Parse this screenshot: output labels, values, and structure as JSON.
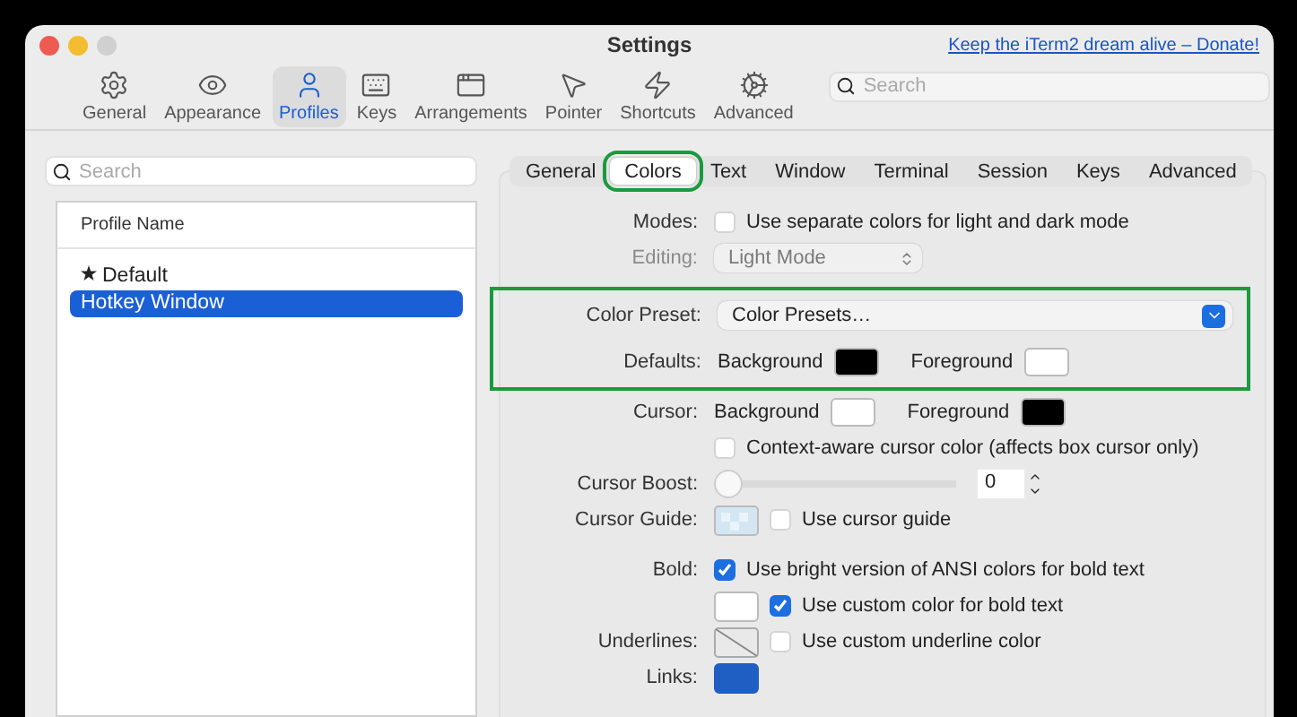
{
  "window": {
    "title": "Settings",
    "link": "Keep the iTerm2 dream alive – Donate!"
  },
  "toolbar": [
    {
      "label": "General",
      "kind": "general",
      "selected": false
    },
    {
      "label": "Appearance",
      "kind": "appearance",
      "selected": false
    },
    {
      "label": "Profiles",
      "kind": "profiles",
      "selected": true
    },
    {
      "label": "Keys",
      "kind": "keys",
      "selected": false
    },
    {
      "label": "Arrangements",
      "kind": "arrangements",
      "selected": false
    },
    {
      "label": "Pointer",
      "kind": "pointer",
      "selected": false
    },
    {
      "label": "Shortcuts",
      "kind": "shortcuts",
      "selected": false
    },
    {
      "label": "Advanced",
      "kind": "advanced",
      "selected": false
    }
  ],
  "toolbar_search": {
    "placeholder": "Search"
  },
  "profiles": {
    "search": {
      "placeholder": "Search"
    },
    "column": "Profile Name",
    "items": [
      {
        "name": "Default",
        "default": true,
        "selected": false
      },
      {
        "name": "Hotkey Window",
        "default": false,
        "selected": true
      }
    ]
  },
  "tabs": [
    {
      "label": "General",
      "selected": false,
      "highlighted": false
    },
    {
      "label": "Colors",
      "selected": true,
      "highlighted": true
    },
    {
      "label": "Text",
      "selected": false,
      "highlighted": false
    },
    {
      "label": "Window",
      "selected": false,
      "highlighted": false
    },
    {
      "label": "Terminal",
      "selected": false,
      "highlighted": false
    },
    {
      "label": "Session",
      "selected": false,
      "highlighted": false
    },
    {
      "label": "Keys",
      "selected": false,
      "highlighted": false
    },
    {
      "label": "Advanced",
      "selected": false,
      "highlighted": false
    }
  ],
  "modes": {
    "label": "Modes:",
    "option": "Use separate colors for light and dark mode",
    "checked": false
  },
  "editing": {
    "label": "Editing:",
    "value": "Light Mode",
    "disabled": true
  },
  "preset_group": {
    "highlighted": true,
    "color_preset": {
      "label": "Color Preset:",
      "value": "Color Presets…"
    },
    "defaults": {
      "label": "Defaults:",
      "background": {
        "label": "Background",
        "color": "#000000"
      },
      "foreground": {
        "label": "Foreground",
        "color": "#ffffff"
      }
    }
  },
  "cursor": {
    "label": "Cursor:",
    "background": {
      "label": "Background",
      "color": "#ffffff"
    },
    "foreground": {
      "label": "Foreground",
      "color": "#000000"
    }
  },
  "context_aware": {
    "option": "Context-aware cursor color (affects box cursor only)",
    "checked": false
  },
  "cursor_boost": {
    "label": "Cursor Boost:",
    "level": 0,
    "value": "0"
  },
  "cursor_guide": {
    "label": "Cursor Guide:",
    "option": "Use cursor guide",
    "checked": false
  },
  "bold": {
    "label": "Bold:",
    "option": "Use bright version of ANSI colors for bold text",
    "checked": true
  },
  "bold_color": {
    "option": "Use custom color for bold text",
    "checked": true,
    "color": "#ffffff"
  },
  "underlines": {
    "label": "Underlines:",
    "option": "Use custom underline color",
    "checked": false
  },
  "links": {
    "label": "Links:",
    "color": "#1f5fc4"
  }
}
